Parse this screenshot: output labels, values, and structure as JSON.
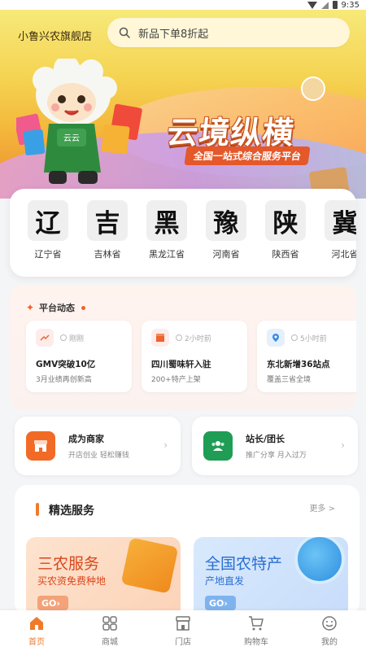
{
  "status_bar": {
    "time": "9:35"
  },
  "header": {
    "store_name": "小鲁兴农旗舰店",
    "search_placeholder": "新品下单8折起"
  },
  "banner": {
    "title": "云境纵横",
    "subtitle": "全国一站式综合服务平台",
    "mascot_label": "云云"
  },
  "provinces": [
    {
      "glyph": "辽",
      "name": "辽宁省"
    },
    {
      "glyph": "吉",
      "name": "吉林省"
    },
    {
      "glyph": "黑",
      "name": "黑龙江省"
    },
    {
      "glyph": "豫",
      "name": "河南省"
    },
    {
      "glyph": "陕",
      "name": "陕西省"
    },
    {
      "glyph": "冀",
      "name": "河北省"
    }
  ],
  "platform_news": {
    "title": "平台动态",
    "items": [
      {
        "time": "刚刚",
        "title": "GMV突破10亿",
        "desc": "3月业绩再创新高",
        "icon": "trending-up-icon",
        "color": "#f0622c"
      },
      {
        "time": "2小时前",
        "title": "四川蜀味轩入驻",
        "desc": "200+特产上架",
        "icon": "store-icon",
        "color": "#f0622c"
      },
      {
        "time": "5小时前",
        "title": "东北新增36站点",
        "desc": "覆盖三省全境",
        "icon": "location-pin-icon",
        "color": "#3a8de0"
      }
    ]
  },
  "roles": [
    {
      "title": "成为商家",
      "desc": "开店创业 轻松赚钱",
      "icon": "shop-icon",
      "color": "#f26b26"
    },
    {
      "title": "站长/团长",
      "desc": "推广分享 月入过万",
      "icon": "team-icon",
      "color": "#1f9d55"
    }
  ],
  "featured": {
    "title": "精选服务",
    "more": "更多 >",
    "promos": [
      {
        "title": "三农服务",
        "sub": "买农资免费种地",
        "go": "GO",
        "title_color": "#d9461c",
        "go_color": "#f3a27a"
      },
      {
        "title": "全国农特产",
        "sub": "产地直发",
        "go": "GO",
        "title_color": "#2a6fd0",
        "go_color": "#7fb3ef"
      }
    ]
  },
  "tabs": [
    {
      "label": "首页",
      "icon": "home-icon",
      "active": true
    },
    {
      "label": "商城",
      "icon": "grid-icon",
      "active": false
    },
    {
      "label": "门店",
      "icon": "storefront-icon",
      "active": false
    },
    {
      "label": "购物车",
      "icon": "cart-icon",
      "active": false
    },
    {
      "label": "我的",
      "icon": "profile-icon",
      "active": false
    }
  ],
  "colors": {
    "accent": "#f07a2a",
    "tab_inactive": "#777777"
  }
}
